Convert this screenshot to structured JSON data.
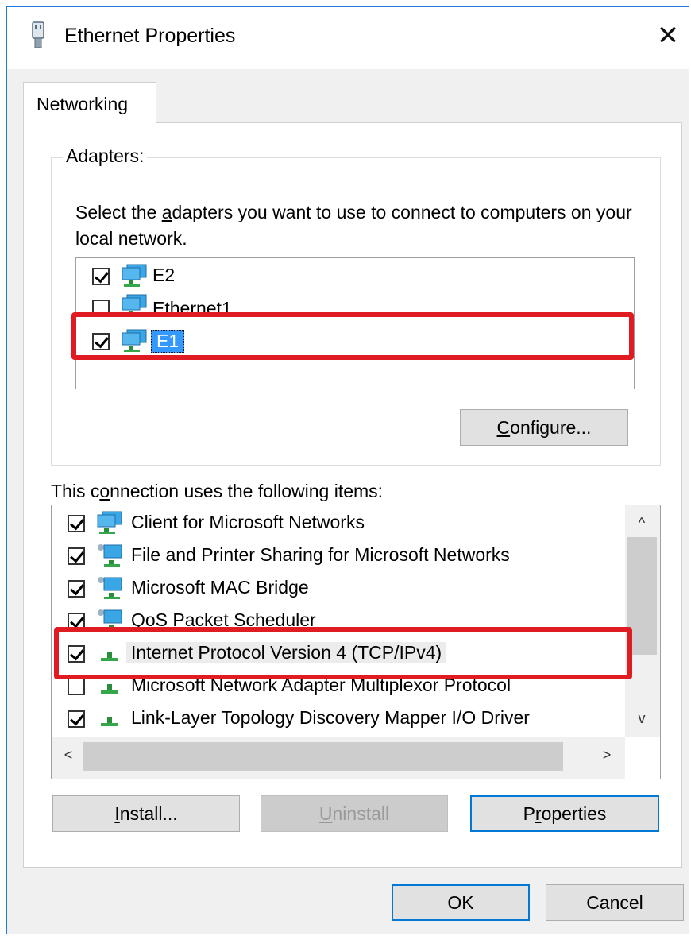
{
  "window": {
    "title": "Ethernet Properties",
    "close_glyph": "✕"
  },
  "tabs": [
    {
      "label": "Networking"
    }
  ],
  "adapters": {
    "legend": "Adapters:",
    "description_pre": "Select the ",
    "description_accel": "a",
    "description_post": "dapters you want to use to connect to computers on your local network.",
    "items": [
      {
        "label": "E2",
        "checked": true,
        "icon": "network-adapter-icon"
      },
      {
        "label": "Ethernet1",
        "checked": false,
        "icon": "network-adapter-icon"
      },
      {
        "label": "E1",
        "checked": true,
        "selected": true,
        "icon": "network-adapter-icon"
      }
    ],
    "configure_accel": "C",
    "configure_rest": "onfigure..."
  },
  "items": {
    "header_pre": "This c",
    "header_accel": "o",
    "header_post": "nnection uses the following items:",
    "list": [
      {
        "label": "Client for Microsoft Networks",
        "checked": true,
        "icon": "network-client-icon"
      },
      {
        "label": "File and Printer Sharing for Microsoft Networks",
        "checked": true,
        "icon": "network-service-icon"
      },
      {
        "label": "Microsoft MAC Bridge",
        "checked": true,
        "icon": "network-service-icon"
      },
      {
        "label": "QoS Packet Scheduler",
        "checked": true,
        "icon": "network-service-icon"
      },
      {
        "label": "Internet Protocol Version 4 (TCP/IPv4)",
        "checked": true,
        "icon": "protocol-icon",
        "highlighted": true
      },
      {
        "label": "Microsoft Network Adapter Multiplexor Protocol",
        "checked": false,
        "icon": "protocol-icon"
      },
      {
        "label": "Link-Layer Topology Discovery Mapper I/O Driver",
        "checked": true,
        "icon": "protocol-icon"
      }
    ],
    "scroll_up": "^",
    "scroll_down": "v",
    "scroll_left": "<",
    "scroll_right": ">"
  },
  "buttons": {
    "install_accel": "I",
    "install_rest": "nstall...",
    "uninstall_accel": "U",
    "uninstall_rest": "ninstall",
    "properties_pre": "P",
    "properties_accel": "r",
    "properties_post": "operties",
    "ok": "OK",
    "cancel": "Cancel"
  },
  "colors": {
    "accent": "#0078d7",
    "annotation_red": "#e11b22",
    "selection": "#3399ff"
  }
}
